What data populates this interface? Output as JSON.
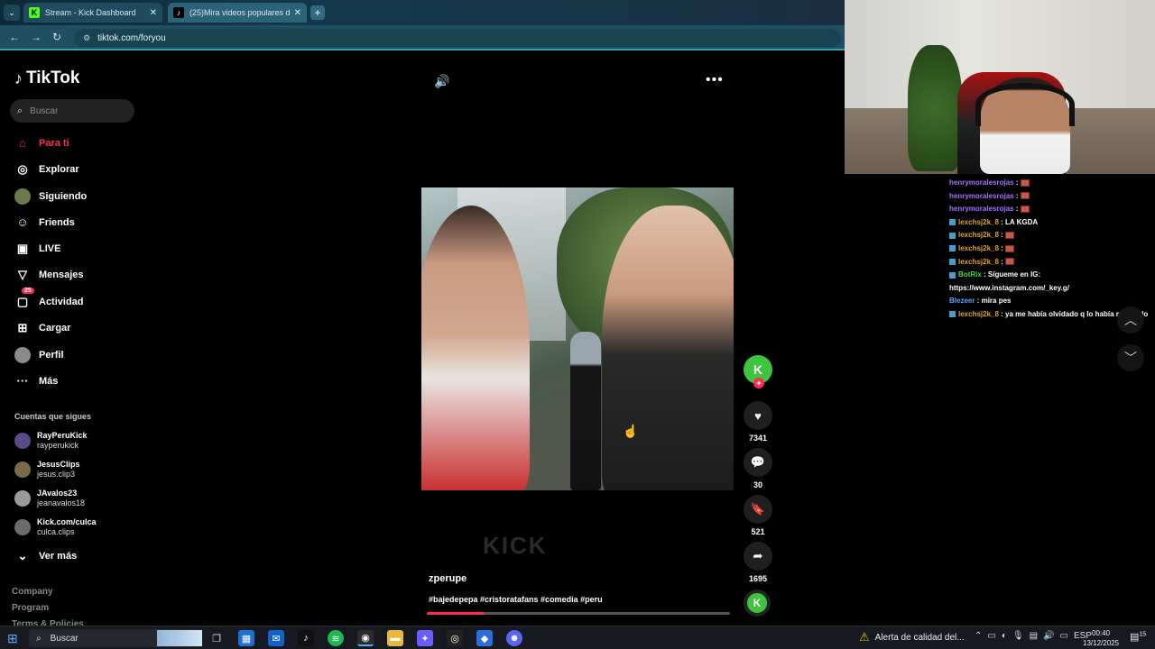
{
  "browser": {
    "tabs": [
      {
        "label": "Stream - Kick Dashboard",
        "favicon": "kick-logo"
      },
      {
        "label": "(25)Mira videos populares d",
        "favicon": "tiktok-logo"
      }
    ],
    "url": "tiktok.com/foryou"
  },
  "tiktok": {
    "logo": "TikTok",
    "search_placeholder": "Buscar",
    "nav": [
      {
        "label": "Para ti",
        "icon": "home-icon",
        "active": true
      },
      {
        "label": "Explorar",
        "icon": "compass-icon"
      },
      {
        "label": "Siguiendo",
        "icon": "following-avatar"
      },
      {
        "label": "Friends",
        "icon": "friends-icon"
      },
      {
        "label": "LIVE",
        "icon": "live-icon"
      },
      {
        "label": "Mensajes",
        "icon": "messages-icon"
      },
      {
        "label": "Actividad",
        "icon": "activity-icon",
        "badge": "25"
      },
      {
        "label": "Cargar",
        "icon": "upload-icon"
      },
      {
        "label": "Perfil",
        "icon": "profile-avatar"
      },
      {
        "label": "Más",
        "icon": "more-icon"
      }
    ],
    "following_title": "Cuentas que sigues",
    "following": [
      {
        "name": "RayPeruKick",
        "handle": "rayperukick"
      },
      {
        "name": "JesusClips",
        "handle": "jesus.clip3"
      },
      {
        "name": "JAvalos23",
        "handle": "jeanavalos18"
      },
      {
        "name": "Kick.com/culca",
        "handle": "culca.clips"
      }
    ],
    "see_more": "Ver más",
    "footer": [
      "Company",
      "Program",
      "Terms & Policies"
    ]
  },
  "video": {
    "author": "zperupe",
    "description": "#bajedepepa #cristoratafans #comedia #peru",
    "watermark": "KICK",
    "progress": 0.19,
    "likes": "7341",
    "comments": "30",
    "saves": "521",
    "shares": "1695"
  },
  "chat": {
    "messages": [
      {
        "user": "henrymoralesrojas",
        "text": "",
        "emote": true,
        "color": "purple"
      },
      {
        "user": "henrymoralesrojas",
        "text": "",
        "emote": true,
        "color": "purple"
      },
      {
        "user": "henrymoralesrojas",
        "text": "",
        "emote": true,
        "color": "purple"
      },
      {
        "user": "lexchsj2k_8",
        "text": "LA KGDA",
        "emote": false,
        "color": "gold"
      },
      {
        "user": "lexchsj2k_8",
        "text": "",
        "emote": true,
        "color": "gold"
      },
      {
        "user": "lexchsj2k_8",
        "text": "",
        "emote": true,
        "color": "gold"
      },
      {
        "user": "lexchsj2k_8",
        "text": "",
        "emote": true,
        "color": "gold"
      },
      {
        "user": "BotRix",
        "text": "Sígueme en IG:",
        "emote": false,
        "color": "green"
      },
      {
        "user": "",
        "text": "https://www.instagram.com/_key.g/",
        "emote": false,
        "color": ""
      },
      {
        "user": "Blezeer",
        "text": "mira pes",
        "emote": false,
        "color": "blue"
      },
      {
        "user": "lexchsj2k_8",
        "text": "ya me había olvidado q lo había mandado",
        "emote": false,
        "color": "gold"
      }
    ]
  },
  "taskbar": {
    "search_label": "Buscar",
    "alert_text": "Alerta de calidad del...",
    "lang": "ESP",
    "time": "00:40",
    "date": "13/12/2025",
    "notif_count": "15"
  }
}
